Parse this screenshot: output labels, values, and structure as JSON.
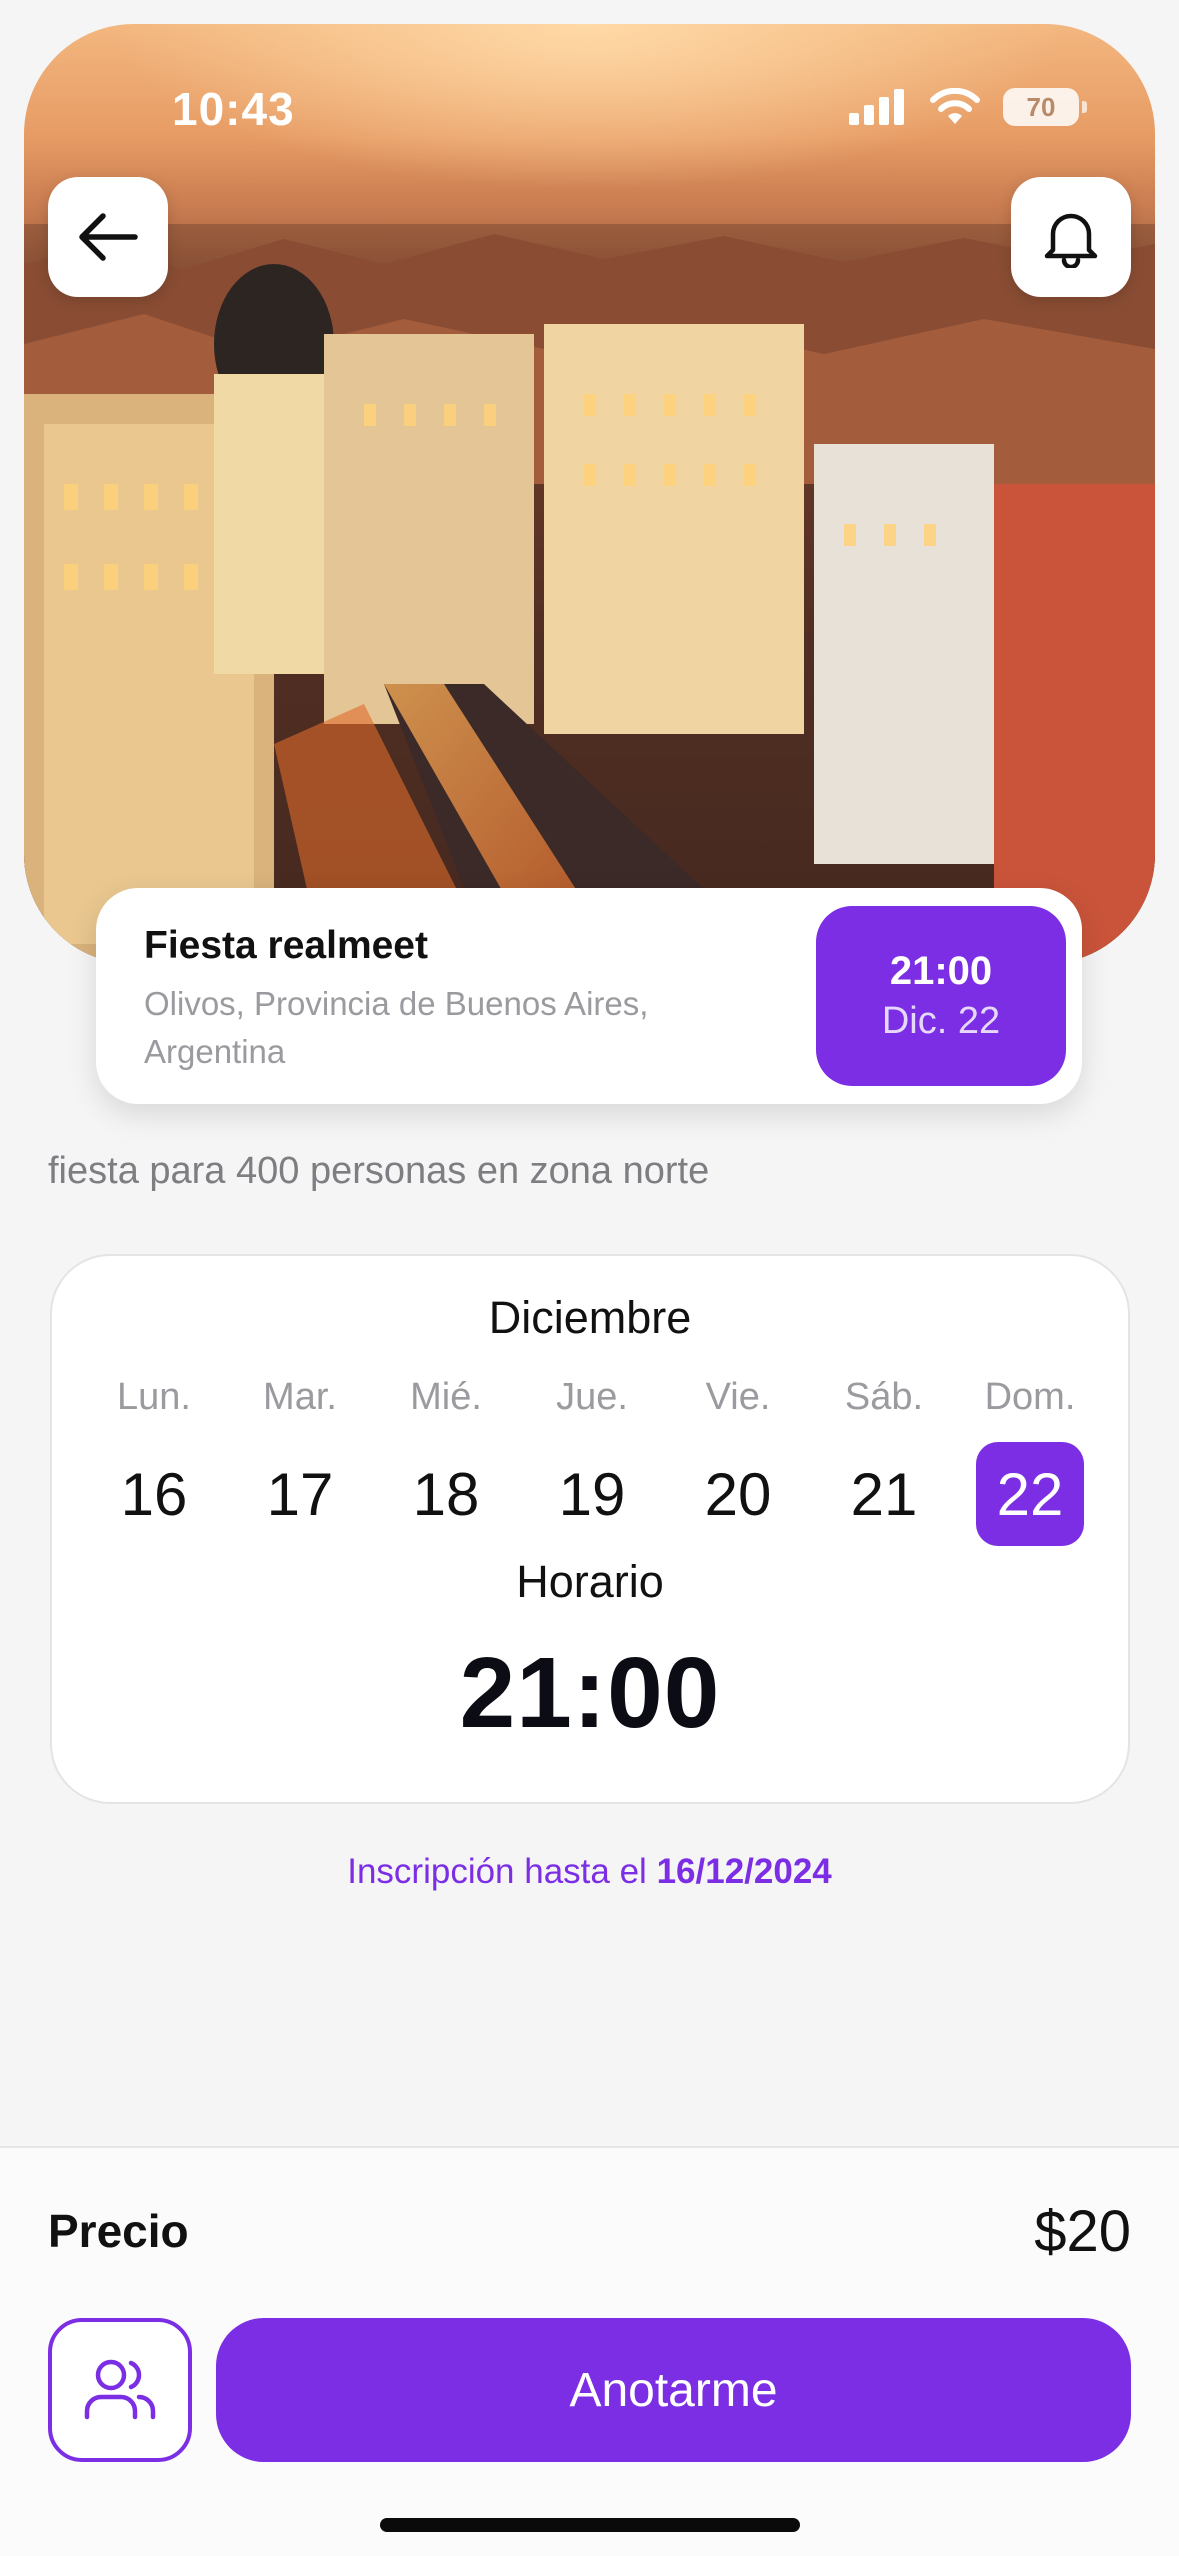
{
  "status_bar": {
    "time": "10:43",
    "battery": "70"
  },
  "header": {
    "back_icon": "arrow-left-icon",
    "notify_icon": "bell-icon"
  },
  "event": {
    "title": "Fiesta realmeet",
    "location": "Olivos, Provincia de Buenos Aires, Argentina",
    "badge_time": "21:00",
    "badge_date": "Dic. 22"
  },
  "description": "fiesta para 400 personas en zona norte",
  "calendar": {
    "month": "Diciembre",
    "days": [
      {
        "dow": "Lun.",
        "num": "16"
      },
      {
        "dow": "Mar.",
        "num": "17"
      },
      {
        "dow": "Mié.",
        "num": "18"
      },
      {
        "dow": "Jue.",
        "num": "19"
      },
      {
        "dow": "Vie.",
        "num": "20"
      },
      {
        "dow": "Sáb.",
        "num": "21"
      },
      {
        "dow": "Dom.",
        "num": "22"
      }
    ],
    "selected_day": "22",
    "horario_label": "Horario",
    "horario_time": "21:00"
  },
  "deadline": {
    "prefix": "Inscripción hasta el",
    "date": "16/12/2024"
  },
  "footer": {
    "price_label": "Precio",
    "price_value": "$20",
    "group_icon": "users-icon",
    "cta_label": "Anotarme"
  },
  "colors": {
    "accent": "#7b2ee4",
    "muted": "#9a9a9f"
  }
}
